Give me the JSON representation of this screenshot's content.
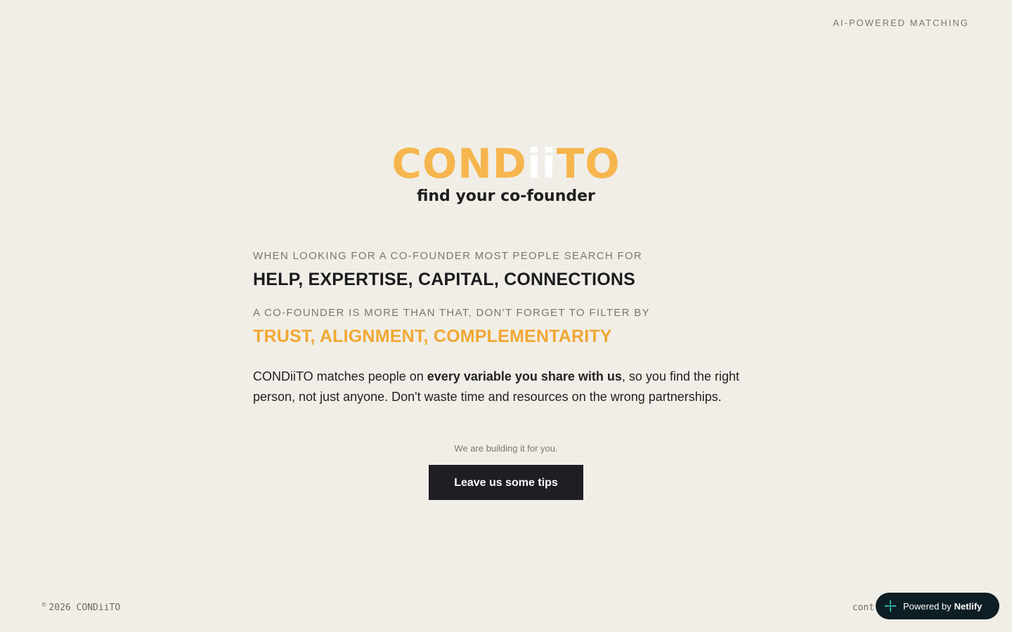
{
  "header": {
    "tag": "AI-POWERED MATCHING"
  },
  "brand": {
    "logo_start": "COND",
    "logo_ii": "ii",
    "logo_end": "TO",
    "tagline": "find your co-founder"
  },
  "intro": {
    "kicker_1": "WHEN LOOKING FOR A CO-FOUNDER MOST PEOPLE SEARCH FOR",
    "headline_1": "HELP, EXPERTISE, CAPITAL, CONNECTIONS",
    "kicker_2": "A CO-FOUNDER IS MORE THAN THAT, DON'T FORGET TO FILTER BY",
    "headline_2": "TRUST, ALIGNMENT, COMPLEMENTARITY",
    "body_part_1": "CONDiiTO matches people on ",
    "body_bold": "every variable you share with us",
    "body_part_2": ", so you find the right person, not just anyone. Don't waste time and resources on the wrong partnerships."
  },
  "cta": {
    "note": "We are building it for you.",
    "button_label": "Leave us some tips"
  },
  "footer": {
    "copyright_symbol": "©",
    "copyright_text": "2026 CONDiiTO",
    "contact_partial": "cont"
  },
  "badge": {
    "prefix": "Powered by",
    "brand": "Netlify",
    "icon": "netlify-spark-icon"
  },
  "colors": {
    "background": "#f1eee8",
    "logo": "#f6b64d",
    "accent": "#f0a833",
    "button": "#1e1e24",
    "badge": "#0e1e25",
    "badge_icon": "#32e6e2"
  }
}
